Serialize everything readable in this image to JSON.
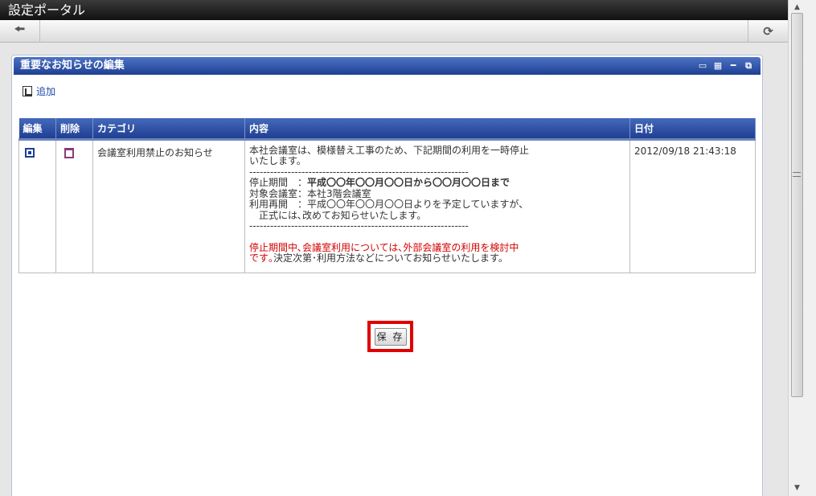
{
  "window": {
    "title": "設定ポータル"
  },
  "toolbar": {
    "back_icon": "back-arrow-icon",
    "reload_icon": "reload-icon"
  },
  "portlet": {
    "title": "重要なお知らせの編集",
    "header_icons": [
      "display-icon",
      "settings-icon",
      "minimize-icon",
      "restore-icon"
    ],
    "add_label": "追加"
  },
  "table": {
    "headers": {
      "edit": "編集",
      "delete": "削除",
      "category": "カテゴリ",
      "content": "内容",
      "date": "日付"
    },
    "rows": [
      {
        "category": "会議室利用禁止のお知らせ",
        "content": {
          "line1": "本社会議室は、模様替え工事のため、下記期間の利用を一時停止",
          "line2": "いたします。",
          "dashes": "---------------------------------------------------------------",
          "period_label": "停止期間　：",
          "period_value": "平成〇〇年〇〇月〇〇日から〇〇月〇〇日まで",
          "target": "対象会議室：本社3階会議室",
          "resume": "利用再開　：平成〇〇年〇〇月〇〇日よりを予定していますが、",
          "resume2": "　正式には､改めてお知らせいたします。",
          "red1": "停止期間中､会議室利用については､外部会議室の利用を検討中",
          "red2": "です｡",
          "tail": "決定次第･利用方法などについてお知らせいたします。"
        },
        "date": "2012/09/18 21:43:18"
      }
    ]
  },
  "save_button": {
    "label": "保 存"
  },
  "colors": {
    "header_blue": "#1f3f92",
    "highlight_red": "#e00000",
    "notice_red": "#d40000"
  }
}
